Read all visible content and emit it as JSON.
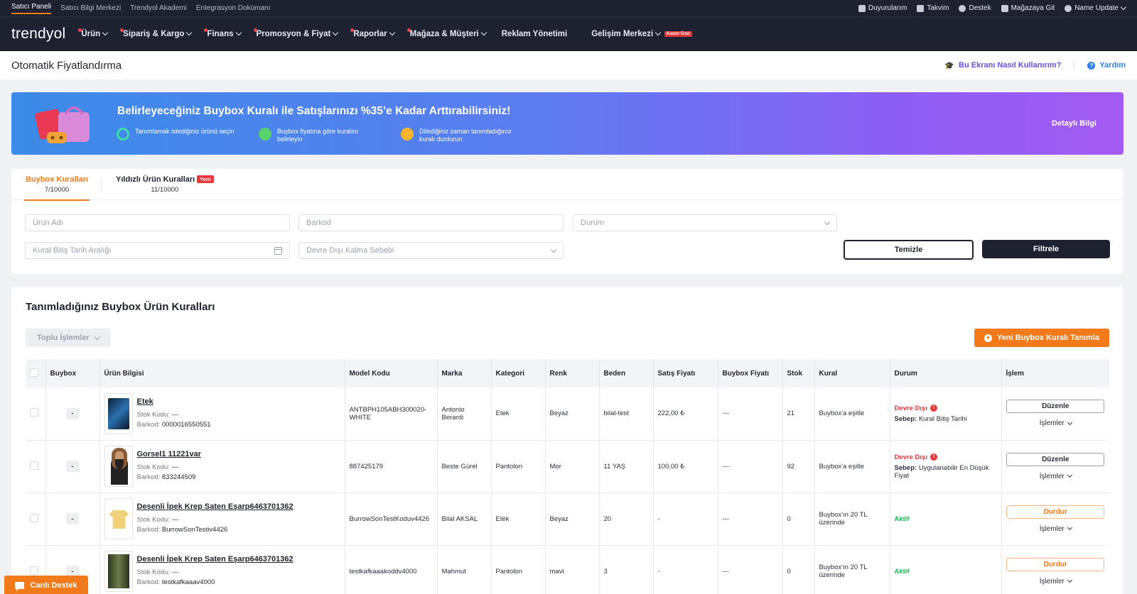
{
  "topbar": {
    "links": [
      "Satıcı Paneli",
      "Satıcı Bilgi Merkezi",
      "Trendyol Akademi",
      "Entegrasyon Dokümanı"
    ],
    "right": {
      "announcements": "Duyurularım",
      "calendar": "Takvim",
      "support": "Destek",
      "store": "Mağazaya Git",
      "user": "Name Update"
    }
  },
  "nav": {
    "logo": "trendyol",
    "items": [
      "Ürün",
      "Sipariş & Kargo",
      "Finans",
      "Promosyon & Fiyat",
      "Raporlar",
      "Mağaza & Müşteri",
      "Reklam Yönetimi",
      "Gelişim Merkezi"
    ],
    "badge": "Kasım Özel"
  },
  "page": {
    "title": "Otomatik Fiyatlandırma",
    "howto": "Bu Ekranı Nasıl Kullanırım?",
    "help": "Yardım"
  },
  "banner": {
    "title": "Belirleyeceğiniz Buybox Kuralı ile Satışlarınızı %35’e Kadar Arttırabilirsiniz!",
    "steps": [
      "Tanımlamak istediğiniz ürünü seçin",
      "Buybox fiyatına göre kuralını belirleyin",
      "Dilediğiniz zaman tanımladığınız kuralı durdurun"
    ],
    "more": "Detaylı Bilgi",
    "colors": [
      "#3b8be8",
      "#a35bf2"
    ]
  },
  "tabs": {
    "buybox_label": "Buybox Kuralları",
    "buybox_count": "7/10000",
    "starred_label": "Yıldızlı Ürün Kuralları",
    "starred_badge": "Yeni",
    "starred_count": "11/10000"
  },
  "filters": {
    "product_name": "Ürün Adı",
    "barcode": "Barkod",
    "status": "Durum",
    "end_date": "Kural Bitiş Tarih Aralığı",
    "disabled_reason": "Devre Dışı Kalma Sebebi",
    "clear": "Temizle",
    "apply": "Filtrele"
  },
  "rules": {
    "title": "Tanımladığınız Buybox Ürün Kuralları",
    "bulk": "Toplu İşlemler",
    "new_rule": "Yeni Buybox Kuralı Tanımla",
    "columns": [
      "Buybox",
      "Ürün Bilgisi",
      "Model Kodu",
      "Marka",
      "Kategori",
      "Renk",
      "Beden",
      "Satış Fiyatı",
      "Buybox Fiyatı",
      "Stok",
      "Kural",
      "Durum",
      "İşlem"
    ],
    "labels": {
      "stock_code": "Stok Kodu:",
      "barcode": "Barkod:",
      "reason": "Sebep:",
      "edit": "Düzenle",
      "stop": "Durdur",
      "actions": "İşlemler",
      "buybox_minus": "-"
    },
    "rows": [
      {
        "name": "Etek",
        "stock_code": "---",
        "barcode": "0000016550551",
        "model": "ANTBPH105ABH300020-WHITE",
        "brand": "Antonio Berardi",
        "category": "Etek",
        "color": "Beyaz",
        "size": "bilal-test",
        "price": "222,00 ₺",
        "buybox_price": "---",
        "stock": "21",
        "rule": "Buybox'a eşitle",
        "status": "Devre Dışı",
        "reason": "Kural Bitiş Tarihi",
        "action": "Düzenle",
        "thumb": "phone"
      },
      {
        "name": "Gorsel1 11221var",
        "stock_code": "---",
        "barcode": "833244509",
        "model": "887425179",
        "brand": "Beste Gürel",
        "category": "Pantolon",
        "color": "Mor",
        "size": "11 YAŞ",
        "price": "100,00 ₺",
        "buybox_price": "---",
        "stock": "92",
        "rule": "Buybox'a eşitle",
        "status": "Devre Dışı",
        "reason": "Uygulanabilir En Düşük Fiyat",
        "action": "Düzenle",
        "thumb": "person"
      },
      {
        "name": "Desenli İpek Krep Saten Eşarp6463701362",
        "stock_code": "---",
        "barcode": "BurrowSonTestiv4426",
        "model": "BurrowSonTestKoduv4426",
        "brand": "Bilal AKSAL",
        "category": "Etek",
        "color": "Beyaz",
        "size": "20",
        "price": "-",
        "buybox_price": "---",
        "stock": "0",
        "rule": "Buybox'ın 20 TL üzerinde",
        "status": "Aktif",
        "reason": "",
        "action": "Durdur",
        "thumb": "shirt"
      },
      {
        "name": "Desenli İpek Krep Saten Eşarp6463701362",
        "stock_code": "---",
        "barcode": "testkafkaaav4000",
        "model": "testkafkaaakoddv4000",
        "brand": "Mahmut",
        "category": "Pantolon",
        "color": "mavi",
        "size": "3",
        "price": "-",
        "buybox_price": "---",
        "stock": "0",
        "rule": "Buybox'ın 20 TL üzerinde",
        "status": "Aktif",
        "reason": "",
        "action": "Durdur",
        "thumb": "forest"
      }
    ]
  },
  "live_support": "Canlı Destek",
  "colors": {
    "accent": "#f27a1a",
    "dark": "#1e2230",
    "danger": "#e5383b",
    "success": "#1db954"
  }
}
